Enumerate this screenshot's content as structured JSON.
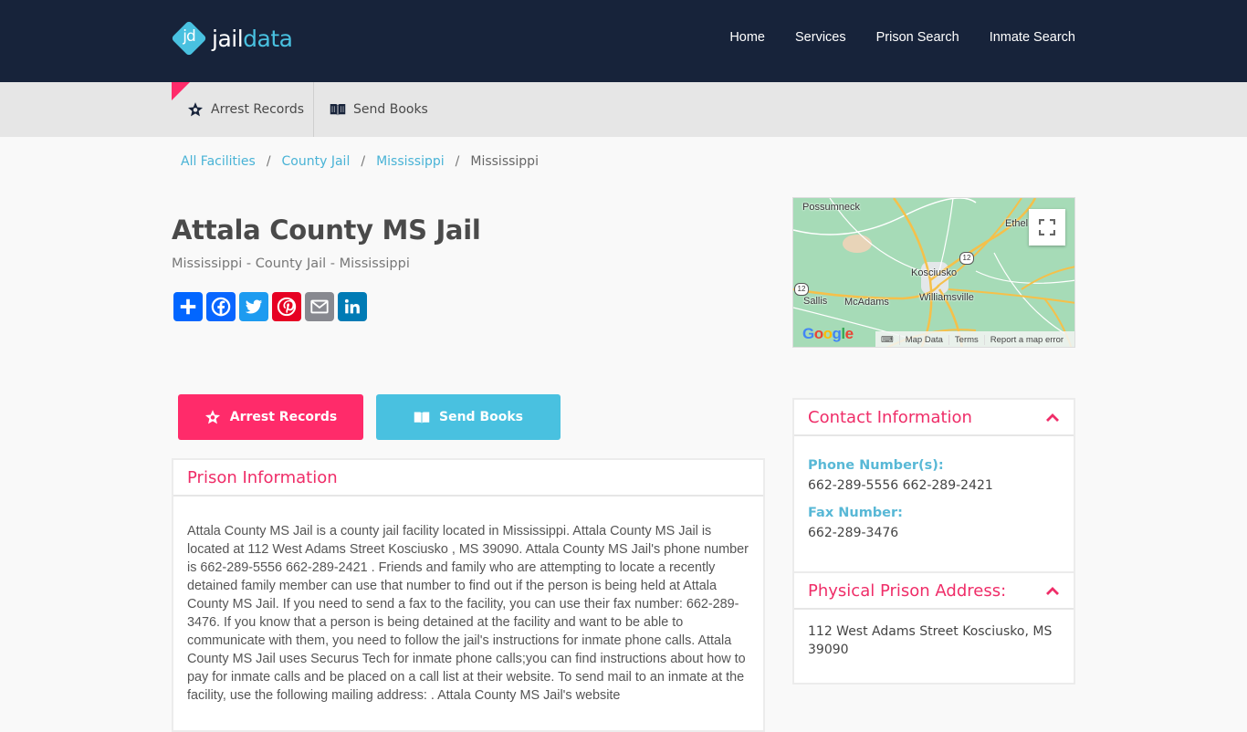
{
  "brand": {
    "mark": "jd",
    "name_part1": "jail",
    "name_part2": "data",
    "colors": {
      "navy": "#17233a",
      "cyan": "#49c1e0",
      "pink": "#ff2b6a"
    }
  },
  "main_nav": [
    {
      "label": "Home"
    },
    {
      "label": "Services"
    },
    {
      "label": "Prison Search"
    },
    {
      "label": "Inmate Search"
    }
  ],
  "sub_nav": [
    {
      "label": "Arrest Records",
      "icon": "star-badge-icon"
    },
    {
      "label": "Send Books",
      "icon": "book-icon"
    }
  ],
  "breadcrumb": [
    {
      "label": "All Facilities",
      "link": true
    },
    {
      "label": "County Jail",
      "link": true
    },
    {
      "label": "Mississippi",
      "link": true
    },
    {
      "label": "Mississippi",
      "link": false
    }
  ],
  "breadcrumb_sep": "/",
  "page": {
    "title": "Attala County MS Jail",
    "subtitle": "Mississippi - County Jail - Mississippi"
  },
  "share_buttons": [
    {
      "name": "share",
      "icon": "plus-icon",
      "color": "#0166ff"
    },
    {
      "name": "facebook",
      "icon": "facebook-icon",
      "color": "#0866ff"
    },
    {
      "name": "twitter",
      "icon": "twitter-icon",
      "color": "#1d9bf0"
    },
    {
      "name": "pinterest",
      "icon": "pinterest-icon",
      "color": "#e60023"
    },
    {
      "name": "email",
      "icon": "email-icon",
      "color": "#888990"
    },
    {
      "name": "linkedin",
      "icon": "linkedin-icon",
      "color": "#007bb5"
    }
  ],
  "map": {
    "places": [
      "Possumneck",
      "Ethel",
      "Kosciusko",
      "Williamsville",
      "Sallis",
      "McAdams"
    ],
    "route_shields": [
      "12",
      "12"
    ],
    "google_logo": "Google",
    "attribution": [
      "Map Data",
      "Terms",
      "Report a map error"
    ]
  },
  "actions": {
    "arrest_records": "Arrest Records",
    "send_books": "Send Books"
  },
  "prison_info": {
    "heading": "Prison Information",
    "body": "Attala County MS Jail is a county jail facility located in Mississippi. Attala County MS Jail is located at 112 West Adams Street Kosciusko , MS 39090. Attala County MS Jail's phone number is 662-289-5556 662-289-2421 . Friends and family who are attempting to locate a recently detained family member can use that number to find out if the person is being held at Attala County MS Jail. If you need to send a fax to the facility, you can use their fax number: 662-289-3476. If you know that a person is being detained at the facility and want to be able to communicate with them, you need to follow the jail's instructions for inmate phone calls. Attala County MS Jail uses Securus Tech for inmate phone calls;you can find instructions about how to pay for inmate calls and be placed on a call list at their website. To send mail to an inmate at the facility, use the following mailing address: . Attala County MS Jail's website"
  },
  "contact": {
    "heading": "Contact Information",
    "phone_label": "Phone Number(s):",
    "phone_value": "662-289-5556 662-289-2421",
    "fax_label": "Fax Number:",
    "fax_value": "662-289-3476"
  },
  "address": {
    "heading": "Physical Prison Address:",
    "value": "112 West Adams Street Kosciusko, MS 39090"
  }
}
